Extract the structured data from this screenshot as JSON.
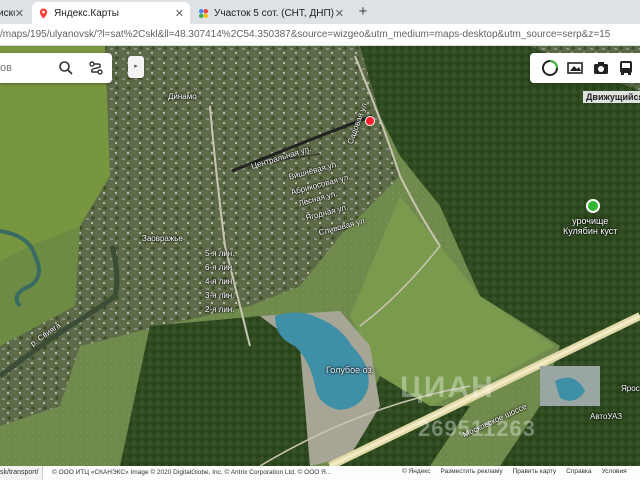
{
  "tabs": [
    {
      "title": "иском ашл",
      "active": false
    },
    {
      "title": "Яндекс.Карты",
      "active": true
    },
    {
      "title": "Участок 5 сот. (СНТ, ДНП)",
      "active": false
    }
  ],
  "address_bar": {
    "url": "/maps/195/ulyanovsk/?l=sat%2Cskl&ll=48.307414%2C54.350387&source=wizgeo&utm_medium=maps-desktop&utm_source=serp&z=15"
  },
  "search": {
    "query": "ов"
  },
  "map": {
    "labels": {
      "dinamo": "Динамо",
      "zavolzhe": "Заовражье",
      "svyaga": "р. Свияга",
      "lake": "Голубое оз.",
      "traffic": "Движущийся т",
      "poi": "урочище\nКулябин куст",
      "road": "Московское шоссе",
      "autouaz": "АвтоУАЗ",
      "yaroslavl": "Ярос"
    },
    "streets": [
      "Центральная ул.",
      "Садовая ул.",
      "Вишнёвая ул.",
      "Абрикосовая ул.",
      "Лесная ул.",
      "Ягодная ул.",
      "Сливовая ул.",
      "5-я лин.",
      "6-я лин.",
      "4-я лин.",
      "3-я лин.",
      "2-я лин."
    ],
    "watermark": "ЦИАН",
    "watermark_id": "269511263",
    "pin_color": "#ff1f2a"
  },
  "status_url": "sk/transport/",
  "copyright": "© ООО ИТЦ «СКАНЭКС» Image © 2020 DigitalGlobe, Inc. © Antrix Corporation Ltd. © ООО Я...",
  "footer_links": [
    "© Яндекс",
    "Разместить рекламу",
    "Править карту",
    "Справка",
    "Условия"
  ]
}
